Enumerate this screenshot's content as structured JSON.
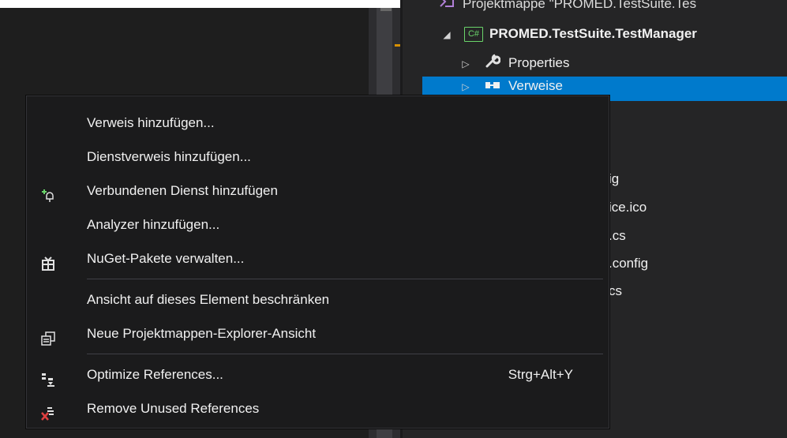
{
  "solution_explorer": {
    "solution_label": "Projektmappe \"PROMED.TestSuite.Tes",
    "project_label": "PROMED.TestSuite.TestManager",
    "project_badge": "C#",
    "properties_label": "Properties",
    "references_label": "Verweise",
    "partial_items": [
      "ig",
      "ice.ico",
      ".cs",
      ".config",
      "cs"
    ]
  },
  "context_menu": {
    "items": [
      {
        "label": "Verweis hinzufügen...",
        "icon": "none"
      },
      {
        "label": "Dienstverweis hinzufügen...",
        "icon": "none"
      },
      {
        "label": "Verbundenen Dienst hinzufügen",
        "icon": "connected-service-icon"
      },
      {
        "label": "Analyzer hinzufügen...",
        "icon": "none"
      },
      {
        "label": "NuGet-Pakete verwalten...",
        "icon": "nuget-package-icon"
      },
      {
        "label": "Ansicht auf dieses Element beschränken",
        "icon": "none"
      },
      {
        "label": "Neue Projektmappen-Explorer-Ansicht",
        "icon": "new-explorer-view-icon"
      },
      {
        "label": "Optimize References...",
        "icon": "optimize-references-icon",
        "shortcut": "Strg+Alt+Y"
      },
      {
        "label": "Remove Unused References",
        "icon": "remove-unused-references-icon"
      }
    ]
  },
  "colors": {
    "selection": "#007acc",
    "menu_background": "#1b1b1c",
    "panel_background": "#252526",
    "text": "#f1f1f1",
    "csharp_badge": "#6ad46a",
    "solution_icon": "#b180d7",
    "marker": "#d89000"
  }
}
